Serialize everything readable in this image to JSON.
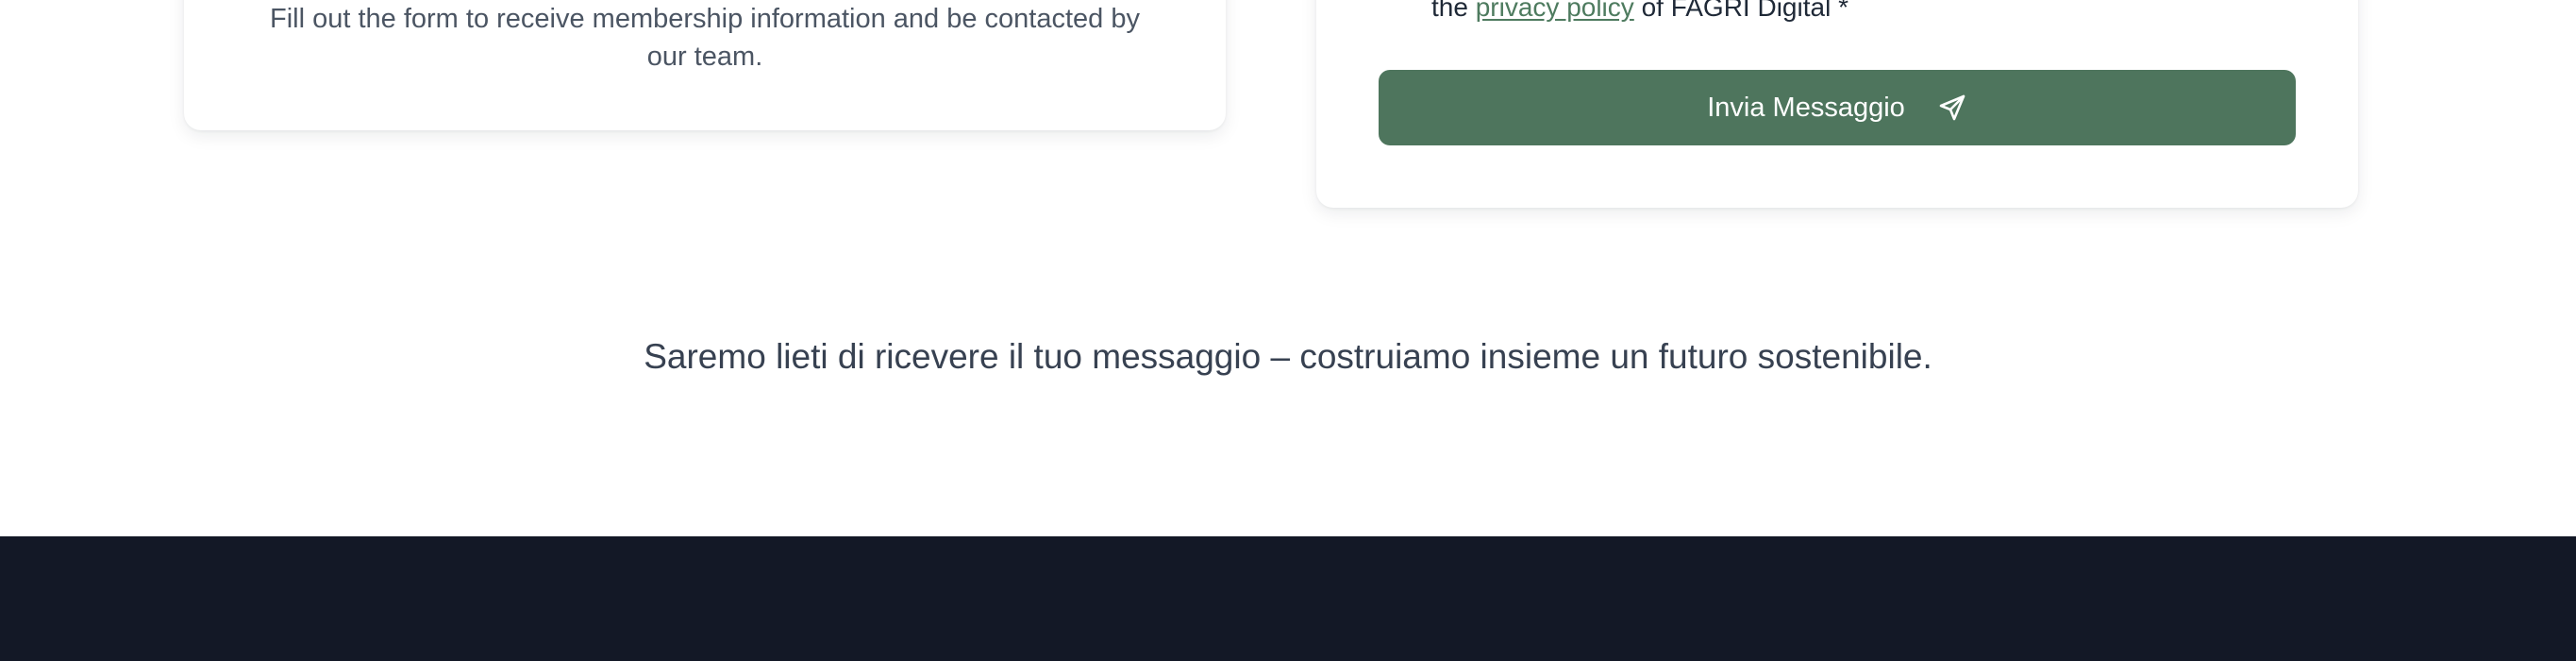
{
  "left_card": {
    "text": "Fill out the form to receive membership information and be contacted by our team."
  },
  "form": {
    "consent_prefix": "the",
    "privacy_link_text": "privacy policy",
    "consent_suffix": "of FAGRI Digital *",
    "submit_label": "Invia Messaggio",
    "submit_icon": "send-icon"
  },
  "closing": {
    "message": "Saremo lieti di ricevere il tuo messaggio – costruiamo insieme un futuro sostenibile."
  },
  "colors": {
    "accent_green": "#4e755d",
    "footer_bg": "#131826"
  }
}
